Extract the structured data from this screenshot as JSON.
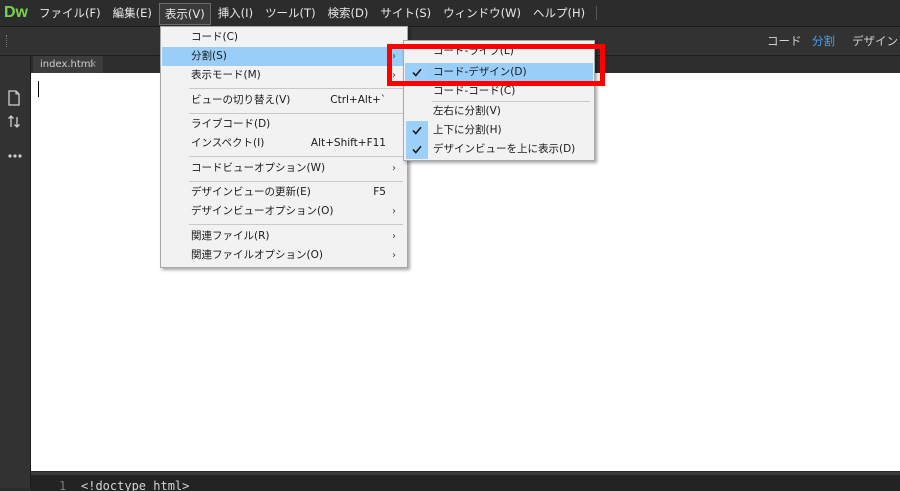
{
  "app": {
    "logo_text": "Dw"
  },
  "menubar": {
    "items": [
      {
        "label": "ファイル(F)"
      },
      {
        "label": "編集(E)"
      },
      {
        "label": "表示(V)"
      },
      {
        "label": "挿入(I)"
      },
      {
        "label": "ツール(T)"
      },
      {
        "label": "検索(D)"
      },
      {
        "label": "サイト(S)"
      },
      {
        "label": "ウィンドウ(W)"
      },
      {
        "label": "ヘルプ(H)"
      }
    ]
  },
  "view_toggles": {
    "code": "コード",
    "split": "分割",
    "design": "デザイン"
  },
  "document": {
    "tab_label": "index.html",
    "tab_close": "×",
    "code_line_number": "1",
    "code_line": "<!doctype html>"
  },
  "view_menu": {
    "items": [
      {
        "label": "コード(C)"
      },
      {
        "label": "分割(S)"
      },
      {
        "label": "表示モード(M)"
      },
      {
        "label": "ビューの切り替え(V)",
        "shortcut": "Ctrl+Alt+`"
      },
      {
        "label": "ライブコード(D)"
      },
      {
        "label": "インスペクト(I)",
        "shortcut": "Alt+Shift+F11"
      },
      {
        "label": "コードビューオプション(W)"
      },
      {
        "label": "デザインビューの更新(E)",
        "shortcut": "F5"
      },
      {
        "label": "デザインビューオプション(O)"
      },
      {
        "label": "関連ファイル(R)"
      },
      {
        "label": "関連ファイルオプション(O)"
      }
    ]
  },
  "split_submenu": {
    "items": [
      {
        "label": "コード-ライブ(L)"
      },
      {
        "label": "コード-デザイン(D)"
      },
      {
        "label": "コード-コード(C)"
      },
      {
        "label": "左右に分割(V)"
      },
      {
        "label": "上下に分割(H)"
      },
      {
        "label": "デザインビューを上に表示(D)"
      }
    ]
  },
  "colors": {
    "accent": "#44a3f4",
    "menu_highlight": "#99cef8",
    "annotation": "#ff0000",
    "logo": "#7ad24a"
  },
  "icons": [
    "file-icon",
    "sort-icon",
    "more-icon",
    "check-icon",
    "chevron-right-icon",
    "close-icon"
  ]
}
